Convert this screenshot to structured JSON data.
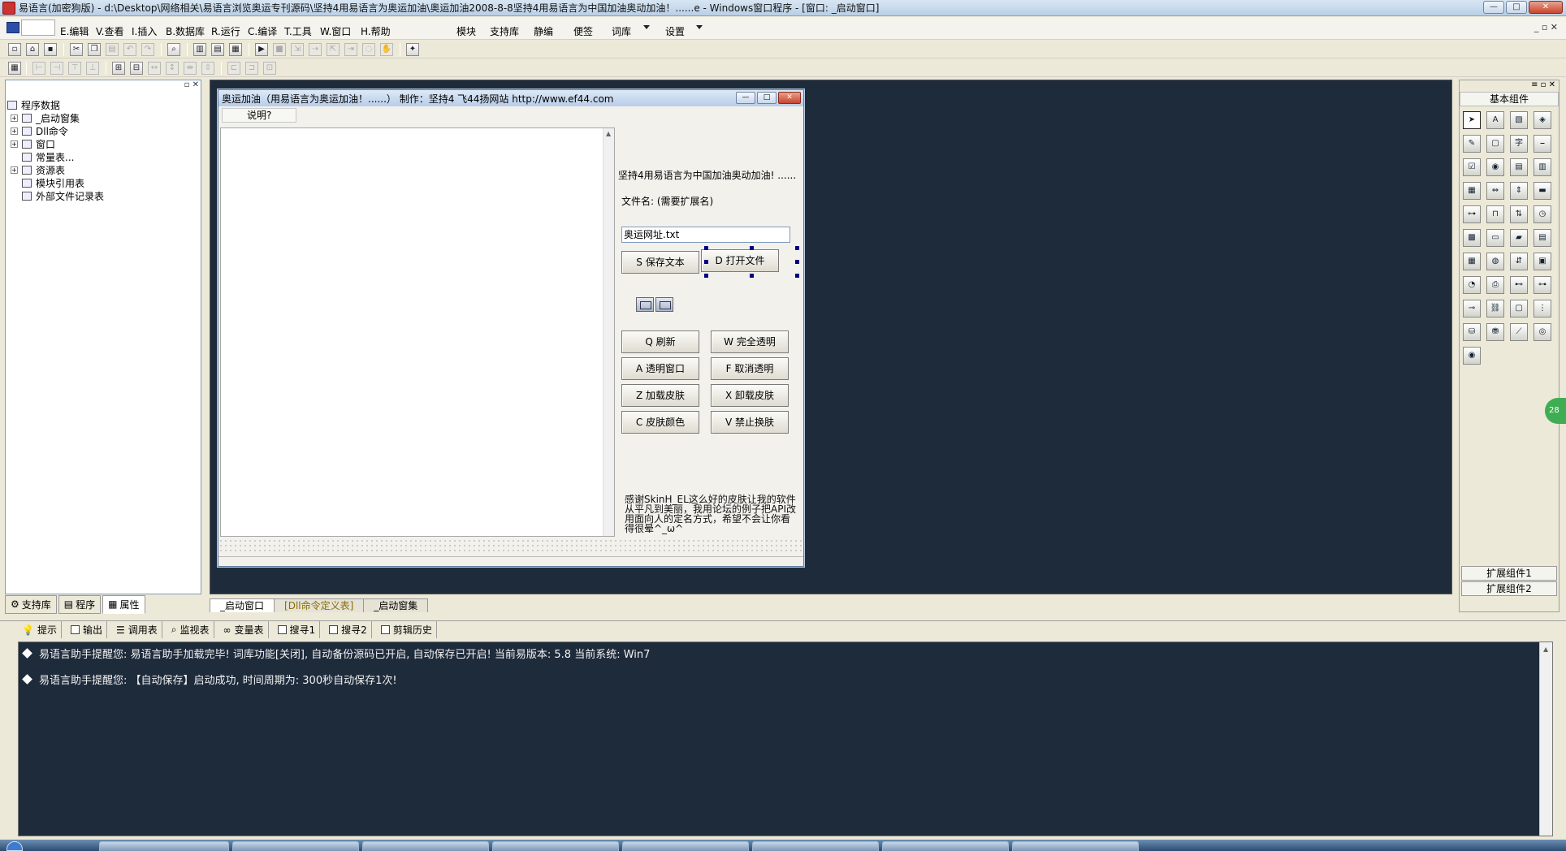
{
  "window": {
    "title": "易语言(加密狗版) - d:\\Desktop\\网络相关\\易语言浏览奥运专刊源码\\坚持4用易语言为奥运加油\\奥运加油2008-8-8坚持4用易语言为中国加油奥动加油！......e - Windows窗口程序 - [窗口: _启动窗口]",
    "min": "—",
    "max": "□",
    "close": "✕"
  },
  "menu": {
    "items": [
      "E.编辑",
      "V.查看",
      "I.插入",
      "B.数据库",
      "R.运行",
      "C.编译",
      "T.工具",
      "W.窗口",
      "H.帮助"
    ],
    "right_items": [
      "模块",
      "支持库",
      "静编",
      "便签",
      "词库",
      "设置"
    ],
    "mdi_controls": "_ ▫ ✕"
  },
  "left_panel": {
    "pin": "▫ ✕",
    "tree": [
      {
        "label": "程序数据",
        "expander": ""
      },
      {
        "label": "_启动窗集",
        "expander": "+"
      },
      {
        "label": "Dll命令",
        "expander": "+"
      },
      {
        "label": "窗口",
        "expander": "+"
      },
      {
        "label": "常量表...",
        "expander": ""
      },
      {
        "label": "资源表",
        "expander": "+"
      },
      {
        "label": "模块引用表",
        "expander": ""
      },
      {
        "label": "外部文件记录表",
        "expander": ""
      }
    ],
    "tabs": [
      "支持库",
      "程序",
      "属性"
    ]
  },
  "form": {
    "title": "奥运加油（用易语言为奥运加油！......）        制作：坚持4  飞44扬网站 http://www.ef44.com",
    "menu_item": "说明?",
    "slogan": "坚持4用易语言为中国加油奥动加油! ......",
    "filename_label": "文件名: (需要扩展名)",
    "filename_value": "奥运网址.txt",
    "buttons": {
      "save": "S 保存文本",
      "open": "D 打开文件",
      "refresh": "Q 刷新",
      "full_transparent": "W 完全透明",
      "transparent_window": "A 透明窗口",
      "cancel_transparent": "F 取消透明",
      "load_skin": "Z 加载皮肤",
      "unload_skin": "X 卸载皮肤",
      "skin_color": "C 皮肤颜色",
      "disable_skin": "V 禁止换肤"
    },
    "thanks": "感谢SkinH_EL这么好的皮肤让我的软件从平凡到美丽，我用论坛的例子把API改用面向人的定名方式，希望不会让你看得很晕^_ω^"
  },
  "designer_tabs": [
    "_启动窗口",
    "[Dll命令定义表]",
    "_启动窗集"
  ],
  "right_panel": {
    "header": "基本组件",
    "top_icons": "≡ ▫ ✕",
    "ext1": "扩展组件1",
    "ext2": "扩展组件2",
    "badge": "28"
  },
  "output": {
    "tabs": [
      "提示",
      "输出",
      "调用表",
      "监视表",
      "变量表",
      "搜寻1",
      "搜寻2",
      "剪辑历史"
    ],
    "lines": [
      "易语言助手提醒您:  易语言助手加载完毕!  词库功能[关闭], 自动备份源码已开启, 自动保存已开启!  当前易版本: 5.8  当前系统: Win7",
      "易语言助手提醒您: 【自动保存】启动成功, 时间周期为: 300秒自动保存1次!"
    ],
    "close": "✕"
  }
}
